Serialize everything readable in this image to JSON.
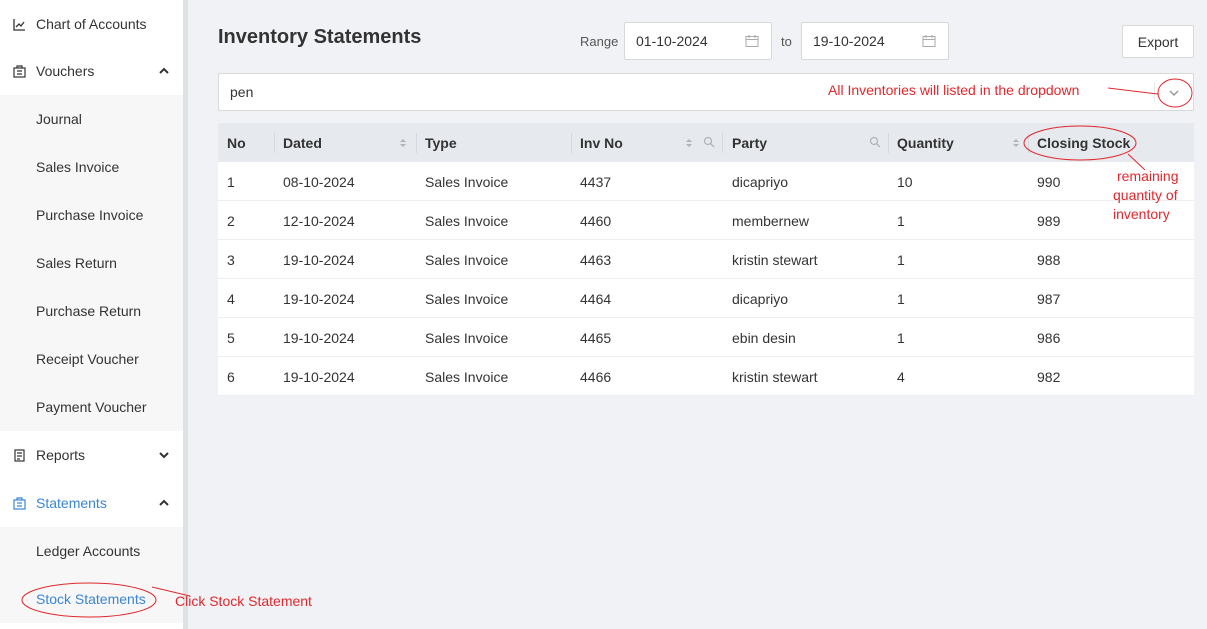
{
  "sidebar": {
    "items": [
      {
        "label": "Chart of Accounts",
        "icon": "chart-icon",
        "level": "top"
      },
      {
        "label": "Vouchers",
        "icon": "voucher-icon",
        "level": "top",
        "caret": "up"
      },
      {
        "label": "Journal",
        "level": "sub"
      },
      {
        "label": "Sales Invoice",
        "level": "sub"
      },
      {
        "label": "Purchase Invoice",
        "level": "sub"
      },
      {
        "label": "Sales Return",
        "level": "sub"
      },
      {
        "label": "Purchase Return",
        "level": "sub"
      },
      {
        "label": "Receipt Voucher",
        "level": "sub"
      },
      {
        "label": "Payment Voucher",
        "level": "sub"
      },
      {
        "label": "Reports",
        "icon": "report-icon",
        "level": "top",
        "caret": "down"
      },
      {
        "label": "Statements",
        "icon": "statements-icon",
        "level": "top",
        "caret": "up",
        "active": true
      },
      {
        "label": "Ledger Accounts",
        "level": "sub"
      },
      {
        "label": "Stock Statements",
        "level": "sub",
        "active": true
      }
    ]
  },
  "header": {
    "title": "Inventory Statements",
    "range_label": "Range",
    "from_date": "01-10-2024",
    "to_label": "to",
    "to_date": "19-10-2024",
    "export_label": "Export"
  },
  "inventory_select": {
    "value": "pen"
  },
  "table": {
    "columns": [
      "No",
      "Dated",
      "Type",
      "Inv No",
      "Party",
      "Quantity",
      "Closing Stock"
    ],
    "rows": [
      [
        "1",
        "08-10-2024",
        "Sales Invoice",
        "4437",
        "dicapriyo",
        "10",
        "990"
      ],
      [
        "2",
        "12-10-2024",
        "Sales Invoice",
        "4460",
        "membernew",
        "1",
        "989"
      ],
      [
        "3",
        "19-10-2024",
        "Sales Invoice",
        "4463",
        "kristin stewart",
        "1",
        "988"
      ],
      [
        "4",
        "19-10-2024",
        "Sales Invoice",
        "4464",
        "dicapriyo",
        "1",
        "987"
      ],
      [
        "5",
        "19-10-2024",
        "Sales Invoice",
        "4465",
        "ebin desin",
        "1",
        "986"
      ],
      [
        "6",
        "19-10-2024",
        "Sales Invoice",
        "4466",
        "kristin stewart",
        "4",
        "982"
      ]
    ]
  },
  "annotations": {
    "dropdown_note": "All Inventories will listed in the dropdown",
    "closing_note_1": "remaining",
    "closing_note_2": "quantity of",
    "closing_note_3": "inventory",
    "stock_note": "Click Stock Statement"
  },
  "colors": {
    "accent": "#3a86d4",
    "annotation": "#e0282e",
    "header_bg": "#e6e9ed",
    "page_bg": "#f0f2f5"
  }
}
